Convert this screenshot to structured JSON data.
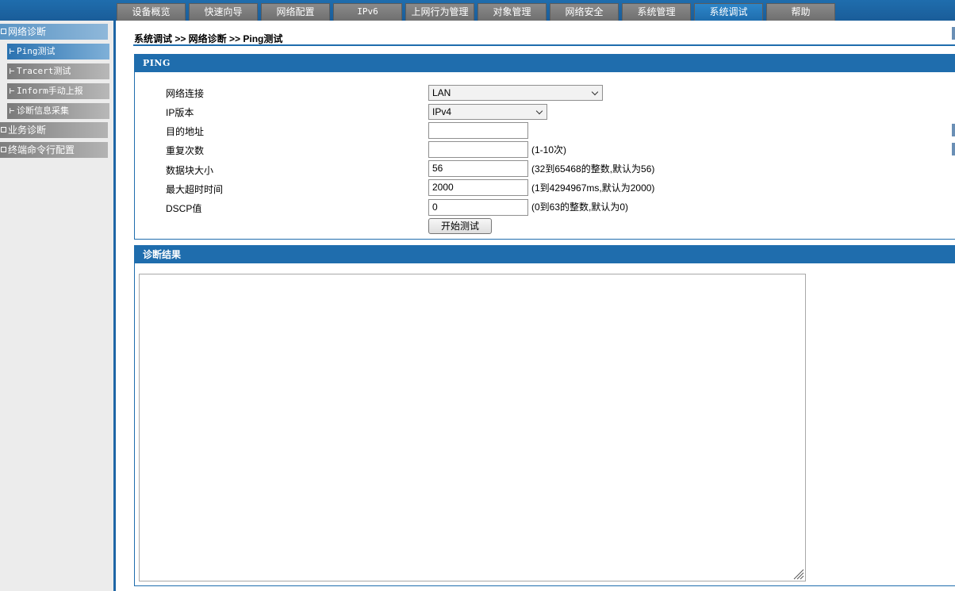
{
  "nav": {
    "tabs": [
      {
        "label": "设备概览",
        "active": false
      },
      {
        "label": "快速向导",
        "active": false
      },
      {
        "label": "网络配置",
        "active": false
      },
      {
        "label": "IPv6",
        "active": false
      },
      {
        "label": "上网行为管理",
        "active": false
      },
      {
        "label": "对象管理",
        "active": false
      },
      {
        "label": "网络安全",
        "active": false
      },
      {
        "label": "系统管理",
        "active": false
      },
      {
        "label": "系统调试",
        "active": true
      },
      {
        "label": "帮助",
        "active": false
      }
    ]
  },
  "sidebar": {
    "groups": [
      {
        "label": "网络诊断",
        "expanded": true,
        "items": [
          {
            "label": "Ping测试",
            "active": true
          },
          {
            "label": "Tracert测试",
            "active": false
          },
          {
            "label": "Inform手动上报",
            "active": false
          },
          {
            "label": "诊断信息采集",
            "active": false
          }
        ]
      },
      {
        "label": "业务诊断",
        "expanded": false
      },
      {
        "label": "终端命令行配置",
        "expanded": false
      }
    ]
  },
  "breadcrumb": "系统调试 >> 网络诊断 >> Ping测试",
  "ping_panel": {
    "title": "PING",
    "fields": {
      "connection": {
        "label": "网络连接",
        "value": "LAN"
      },
      "ip_version": {
        "label": "IP版本",
        "value": "IPv4"
      },
      "destination": {
        "label": "目的地址",
        "value": ""
      },
      "repeat": {
        "label": "重复次数",
        "value": "",
        "hint": "(1-10次)"
      },
      "block_size": {
        "label": "数据块大小",
        "value": "56",
        "hint": "(32到65468的整数,默认为56)"
      },
      "timeout": {
        "label": "最大超时时间",
        "value": "2000",
        "hint": "(1到4294967ms,默认为2000)"
      },
      "dscp": {
        "label": "DSCP值",
        "value": "0",
        "hint": "(0到63的整数,默认为0)"
      }
    },
    "start_button": "开始测试"
  },
  "result_panel": {
    "title": "诊断结果",
    "content": ""
  },
  "colors": {
    "header_blue": "#1f6dad",
    "active_tab": "#2d86c9",
    "inactive_tab": "#7a7a7a",
    "sidebar_bg": "#ececec"
  }
}
